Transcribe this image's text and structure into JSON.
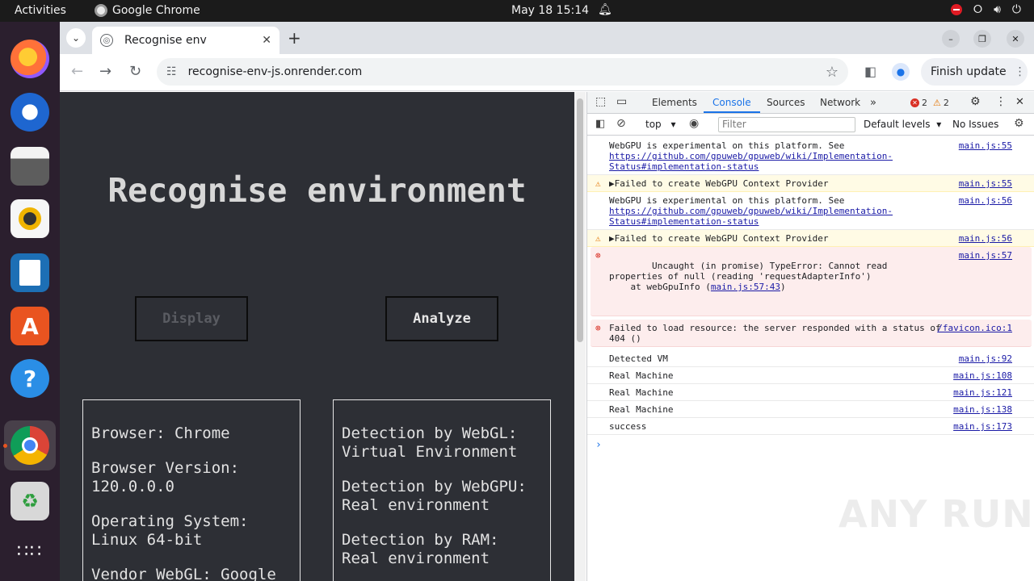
{
  "system": {
    "activities": "Activities",
    "app_name": "Google Chrome",
    "clock": "May 18  15:14"
  },
  "browser": {
    "tab_title": "Recognise env",
    "url": "recognise-env-js.onrender.com",
    "finish_update": "Finish update"
  },
  "page": {
    "title": "Recognise environment",
    "display_button": "Display",
    "analyze_button": "Analyze",
    "left_box": [
      "Browser: Chrome",
      "Browser Version: 120.0.0.0",
      "Operating System: Linux 64-bit",
      "Vendor WebGL: Google"
    ],
    "right_box": [
      "Detection by WebGL: Virtual Environment",
      "Detection by WebGPU: Real environment",
      "Detection by RAM: Real environment"
    ]
  },
  "devtools": {
    "tabs": [
      "Elements",
      "Console",
      "Sources",
      "Network"
    ],
    "error_count": "2",
    "warning_count": "2",
    "context": "top",
    "filter_placeholder": "Filter",
    "levels": "Default levels",
    "issues": "No Issues",
    "messages": [
      {
        "level": "info",
        "text": "WebGPU is experimental on this platform. See ",
        "link": "https://github.com/gpuweb/gpuweb/wiki/Implementation-Status#implementation-status",
        "src": "main.js:55"
      },
      {
        "level": "warn",
        "text": "▶Failed to create WebGPU Context Provider",
        "link": "",
        "src": "main.js:55"
      },
      {
        "level": "info",
        "text": "WebGPU is experimental on this platform. See ",
        "link": "https://github.com/gpuweb/gpuweb/wiki/Implementation-Status#implementation-status",
        "src": "main.js:56"
      },
      {
        "level": "warn",
        "text": "▶Failed to create WebGPU Context Provider",
        "link": "",
        "src": "main.js:56"
      },
      {
        "level": "error",
        "text": "Uncaught (in promise) TypeError: Cannot read properties of null (reading 'requestAdapterInfo')\n    at webGpuInfo (",
        "link": "main.js:57:43",
        "tail": ")",
        "src": "main.js:57"
      },
      {
        "level": "error",
        "text": "Failed to load resource: the server responded with a status of 404 ()",
        "link": "",
        "src": "/favicon.ico:1"
      },
      {
        "level": "info",
        "text": "Detected VM",
        "link": "",
        "src": "main.js:92"
      },
      {
        "level": "info",
        "text": "Real Machine",
        "link": "",
        "src": "main.js:108"
      },
      {
        "level": "info",
        "text": "Real Machine",
        "link": "",
        "src": "main.js:121"
      },
      {
        "level": "info",
        "text": "Real Machine",
        "link": "",
        "src": "main.js:138"
      },
      {
        "level": "info",
        "text": "success",
        "link": "",
        "src": "main.js:173"
      }
    ]
  },
  "watermark": "ANY RUN"
}
